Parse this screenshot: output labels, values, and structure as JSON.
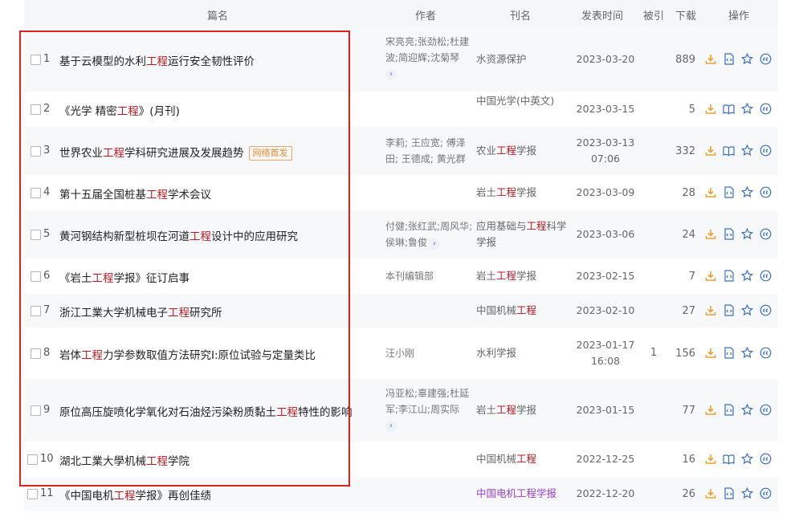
{
  "header": {
    "title": "篇名",
    "authors": "作者",
    "journal": "刊名",
    "date": "发表时间",
    "cited": "被引",
    "downloads": "下载",
    "ops": "操作"
  },
  "rows": [
    {
      "num": "1",
      "title_pre": "基于云模型的水利",
      "title_hl": "工程",
      "title_post": "运行安全韧性评价",
      "badge": "",
      "authors": "宋亮亮;张劲松;杜建波;简迎辉;沈菊琴",
      "more": true,
      "journal_pre": "水资源保护",
      "journal_hl": "",
      "journal_post": "",
      "date": "2023-03-20",
      "time": "",
      "cited": "",
      "downloads": "889",
      "view": "html"
    },
    {
      "num": "2",
      "title_pre": "《光学 精密",
      "title_hl": "工程",
      "title_post": "》(月刊)",
      "badge": "",
      "authors": "",
      "more": false,
      "journal_pre": "中国光学(中英文)",
      "journal_hl": "",
      "journal_post": "",
      "date": "2023-03-15",
      "time": "",
      "cited": "",
      "downloads": "5",
      "view": "book"
    },
    {
      "num": "3",
      "title_pre": "世界农业",
      "title_hl": "工程",
      "title_post": "学科研究进展及发展趋势",
      "badge": "网络首发",
      "authors": "李莉; 王应宽; 傅泽田; 王德成; 黄光群",
      "more": false,
      "journal_pre": "农业",
      "journal_hl": "工程",
      "journal_post": "学报",
      "date": "2023-03-13",
      "time": "07:06",
      "cited": "",
      "downloads": "332",
      "view": "book"
    },
    {
      "num": "4",
      "title_pre": "第十五届全国桩基",
      "title_hl": "工程",
      "title_post": "学术会议",
      "badge": "",
      "authors": "",
      "more": false,
      "journal_pre": "岩土",
      "journal_hl": "工程",
      "journal_post": "学报",
      "date": "2023-03-09",
      "time": "",
      "cited": "",
      "downloads": "28",
      "view": "html"
    },
    {
      "num": "5",
      "title_pre": "黄河钢结构新型桩坝在河道",
      "title_hl": "工程",
      "title_post": "设计中的应用研究",
      "badge": "",
      "authors": "付健;张红武;周风华;侯琳;鲁俊",
      "more": true,
      "journal_pre": "应用基础与",
      "journal_hl": "工程",
      "journal_post": "科学学报",
      "date": "2023-03-06",
      "time": "",
      "cited": "",
      "downloads": "24",
      "view": "html"
    },
    {
      "num": "6",
      "title_pre": "《岩土",
      "title_hl": "工程",
      "title_post": "学报》征订启事",
      "badge": "",
      "authors": "本刊编辑部",
      "more": false,
      "journal_pre": "岩土",
      "journal_hl": "工程",
      "journal_post": "学报",
      "date": "2023-02-15",
      "time": "",
      "cited": "",
      "downloads": "7",
      "view": "html"
    },
    {
      "num": "7",
      "title_pre": "浙江工業大学机械电子",
      "title_hl": "工程",
      "title_post": "研究所",
      "badge": "",
      "authors": "",
      "more": false,
      "journal_pre": "中国机械",
      "journal_hl": "工程",
      "journal_post": "",
      "date": "2023-02-10",
      "time": "",
      "cited": "",
      "downloads": "27",
      "view": "html"
    },
    {
      "num": "8",
      "title_pre": "岩体",
      "title_hl": "工程",
      "title_post": "力学参数取值方法研究Ⅰ:原位试验与定量类比",
      "badge": "",
      "authors": "汪小刚",
      "more": false,
      "journal_pre": "水利学报",
      "journal_hl": "",
      "journal_post": "",
      "date": "2023-01-17",
      "time": "16:08",
      "cited": "1",
      "downloads": "156",
      "view": "html"
    },
    {
      "num": "9",
      "title_pre": "原位高压旋喷化学氧化对石油烃污染粉质黏土",
      "title_hl": "工程",
      "title_post": "特性的影响",
      "badge": "",
      "authors": "冯亚松;辜建强;杜延军;李江山;周实际",
      "more": true,
      "journal_pre": "岩土",
      "journal_hl": "工程",
      "journal_post": "学报",
      "date": "2023-01-15",
      "time": "",
      "cited": "",
      "downloads": "77",
      "view": "html"
    },
    {
      "num": "10",
      "title_pre": "湖北工業大學机械",
      "title_hl": "工程",
      "title_post": "学院",
      "badge": "",
      "authors": "",
      "more": false,
      "journal_pre": "中国机械",
      "journal_hl": "工程",
      "journal_post": "",
      "date": "2022-12-25",
      "time": "",
      "cited": "",
      "downloads": "16",
      "view": "book"
    },
    {
      "num": "11",
      "title_pre": "《中国电机",
      "title_hl": "工程",
      "title_post": "学报》再创佳绩",
      "badge": "",
      "authors": "",
      "more": false,
      "journal_pre": "中国电机",
      "journal_hl": "工程",
      "journal_post": "学报",
      "journal_purple": true,
      "date": "2022-12-20",
      "time": "",
      "cited": "",
      "downloads": "26",
      "view": "html"
    }
  ],
  "colors": {
    "highlight": "#c4161c",
    "annotation_box": "#e0201b",
    "icon_orange": "#f0a030",
    "icon_blue": "#3a6fc4"
  }
}
